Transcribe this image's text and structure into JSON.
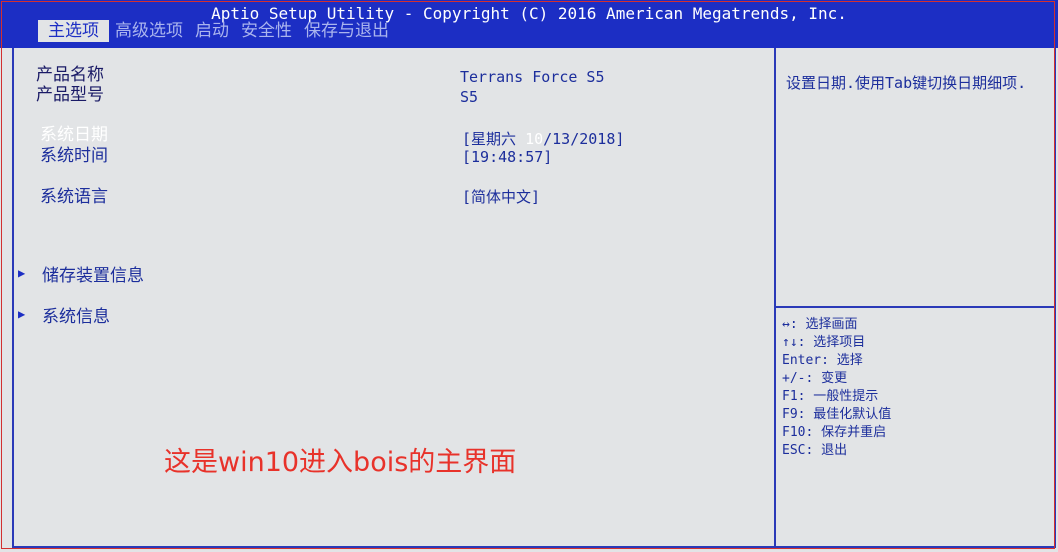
{
  "header": {
    "title": "Aptio Setup Utility - Copyright (C) 2016 American Megatrends, Inc.",
    "tabs": [
      "主选项",
      "高级选项",
      "启动",
      "安全性",
      "保存与退出"
    ]
  },
  "main": {
    "product_name_label": "产品名称",
    "product_name_value": "Terrans Force S5",
    "product_model_label": "产品型号",
    "product_model_value": "S5",
    "system_date_label": "系统日期",
    "system_date_prefix": "[星期六 ",
    "system_date_highlight": "10",
    "system_date_suffix": "/13/2018]",
    "system_time_label": "系统时间",
    "system_time_value": "[19:48:57]",
    "system_language_label": "系统语言",
    "system_language_value": "[简体中文]",
    "submenu_storage": "储存装置信息",
    "submenu_sysinfo": "系统信息"
  },
  "help": {
    "description": "设置日期.使用Tab键切换日期细项.",
    "keys": [
      "↔: 选择画面",
      "↑↓: 选择项目",
      "Enter: 选择",
      "+/-: 变更",
      "F1: 一般性提示",
      "F9: 最佳化默认值",
      "F10: 保存并重启",
      "ESC: 退出"
    ]
  },
  "caption": "这是win10进入bois的主界面",
  "colors": {
    "bios_blue": "#1c2ec4",
    "background": "#e2e4e6",
    "caption_red": "#e8322a"
  }
}
